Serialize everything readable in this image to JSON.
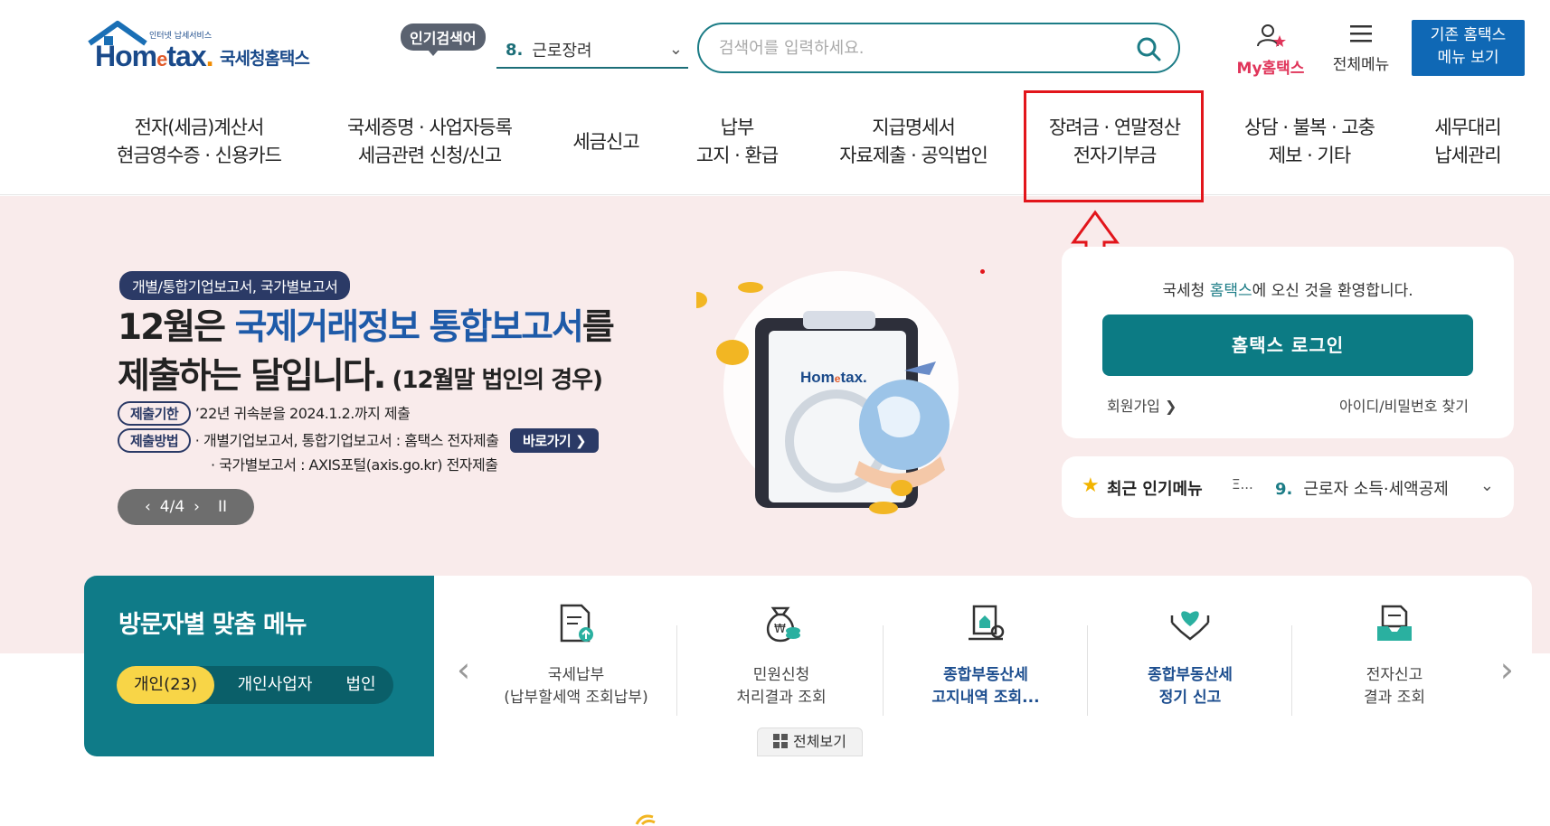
{
  "header": {
    "logo_small": "인터넷 납세서비스",
    "logo_main": "Hom",
    "logo_e": "e",
    "logo_tax": "tax",
    "logo_dot": ".",
    "logo_sub": "국세청홈택스",
    "popular_badge": "인기검색어",
    "popular_num": "8.",
    "popular_term": "근로장려",
    "search_placeholder": "검색어를 입력하세요.",
    "my_hometax": "My홈택스",
    "all_menu": "전체메뉴",
    "legacy_line1": "기존 홈택스",
    "legacy_line2": "메뉴 보기"
  },
  "nav": [
    {
      "line1": "전자(세금)계산서",
      "line2": "현금영수증 · 신용카드"
    },
    {
      "line1": "국세증명 · 사업자등록",
      "line2": "세금관련 신청/신고"
    },
    {
      "line1": "세금신고",
      "line2": ""
    },
    {
      "line1": "납부",
      "line2": "고지 · 환급"
    },
    {
      "line1": "지급명세서",
      "line2": "자료제출 · 공익법인"
    },
    {
      "line1": "장려금 · 연말정산",
      "line2": "전자기부금"
    },
    {
      "line1": "상담 · 불복 · 고충",
      "line2": "제보 · 기타"
    },
    {
      "line1": "세무대리",
      "line2": "납세관리"
    }
  ],
  "hero": {
    "tag": "개별/통합기업보고서, 국가별보고서",
    "title_a": "12월은 ",
    "title_hl": "국제거래정보 통합보고서",
    "title_b": "를",
    "title_c": "제출하는 달입니다.",
    "title_small": " (12월말 법인의 경우)",
    "deadline_label": "제출기한",
    "deadline_text": "’22년 귀속분을 2024.1.2.까지 제출",
    "method_label": "제출방법",
    "method_text1": "· 개별기업보고서, 통합기업보고서 : 홈택스 전자제출",
    "method_text2": "· 국가별보고서 : AXIS포털(axis.go.kr) 전자제출",
    "go_button": "바로가기 ❯",
    "pager_prev": "‹",
    "pager_text": "4/4",
    "pager_next": "›",
    "pager_pause": "II",
    "art_logo": "Hom",
    "art_logo_e": "e",
    "art_logo_tax": "tax."
  },
  "login": {
    "welcome_a": "국세청 ",
    "welcome_hl": "홈택스",
    "welcome_b": "에 오신 것을 환영합니다.",
    "login_button": "홈택스 로그인",
    "signup": "회원가입 ❯",
    "find_id": "아이디/비밀번호 찾기"
  },
  "recent": {
    "title": "최근 인기메뉴",
    "mini": "Ξ...",
    "num": "9.",
    "item": "근로자 소득·세액공제"
  },
  "visitor": {
    "title": "방문자별 맞춤 메뉴",
    "tabs": [
      "개인(23)",
      "개인사업자",
      "법인"
    ]
  },
  "quick": {
    "items": [
      {
        "line1": "국세납부",
        "line2": "(납부할세액 조회납부)"
      },
      {
        "line1": "민원신청",
        "line2": "처리결과 조회"
      },
      {
        "line1": "종합부동산세",
        "line2": "고지내역 조회..."
      },
      {
        "line1": "종합부동산세",
        "line2": "정기 신고"
      },
      {
        "line1": "전자신고",
        "line2": "결과 조회"
      }
    ],
    "view_all": "전체보기",
    "arrow_left": "‹",
    "arrow_right": "›"
  }
}
